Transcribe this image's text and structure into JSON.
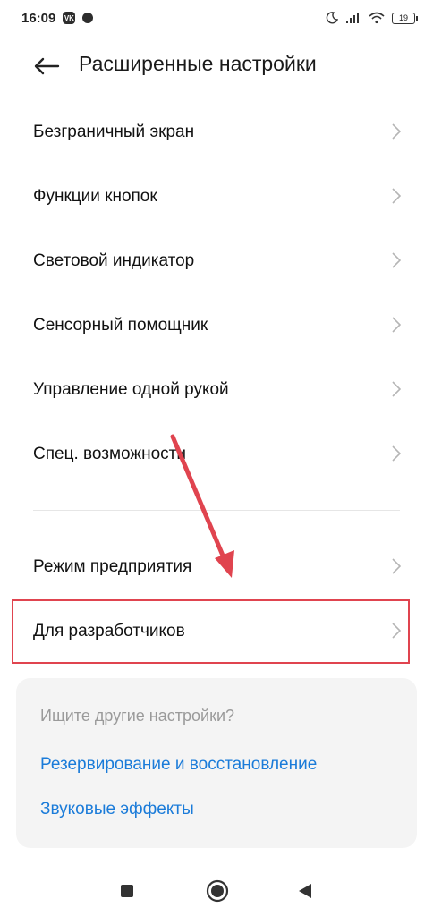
{
  "status_bar": {
    "time": "16:09",
    "vk_label": "VK",
    "battery_level": "19"
  },
  "header": {
    "title": "Расширенные настройки"
  },
  "menu": {
    "items": [
      {
        "label": "Безграничный экран"
      },
      {
        "label": "Функции кнопок"
      },
      {
        "label": "Световой индикатор"
      },
      {
        "label": "Сенсорный помощник"
      },
      {
        "label": "Управление одной рукой"
      },
      {
        "label": "Спец. возможности"
      },
      {
        "label": "Режим предприятия"
      },
      {
        "label": "Для разработчиков"
      }
    ]
  },
  "suggestions": {
    "hint": "Ищите другие настройки?",
    "links": [
      {
        "label": "Резервирование и восстановление"
      },
      {
        "label": "Звуковые эффекты"
      }
    ]
  },
  "colors": {
    "accent_link": "#1a7bd9",
    "annotation_red": "#e0444f"
  }
}
